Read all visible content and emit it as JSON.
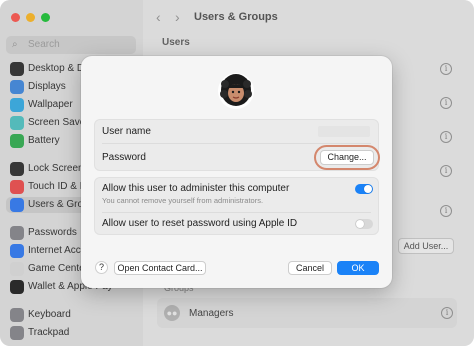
{
  "window": {
    "traffic_colors": [
      "#fe5f57",
      "#febc2e",
      "#28c840"
    ]
  },
  "sidebar": {
    "search_placeholder": "Search",
    "items": [
      {
        "label": "Desktop & Dock",
        "color": "#3a3a3a",
        "icon": "desktop-icon"
      },
      {
        "label": "Displays",
        "color": "#4a90e2",
        "icon": "display-icon"
      },
      {
        "label": "Wallpaper",
        "color": "#3fb2e9",
        "icon": "wallpaper-icon"
      },
      {
        "label": "Screen Saver",
        "color": "#5ac8c8",
        "icon": "screensaver-icon"
      },
      {
        "label": "Battery",
        "color": "#3cb35a",
        "icon": "battery-icon"
      },
      {
        "label": "Lock Screen",
        "color": "#3a3a3a",
        "icon": "lock-icon"
      },
      {
        "label": "Touch ID & Password",
        "color": "#f05656",
        "icon": "fingerprint-icon"
      },
      {
        "label": "Users & Groups",
        "color": "#3b82f6",
        "icon": "users-icon",
        "selected": true
      },
      {
        "label": "Passwords",
        "color": "#8e8e93",
        "icon": "key-icon"
      },
      {
        "label": "Internet Accounts",
        "color": "#3b82f6",
        "icon": "at-icon"
      },
      {
        "label": "Game Center",
        "color": "#e0e0e0",
        "icon": "game-center-icon"
      },
      {
        "label": "Wallet & Apple Pay",
        "color": "#2c2c2c",
        "icon": "wallet-icon"
      },
      {
        "label": "Keyboard",
        "color": "#8e8e93",
        "icon": "keyboard-icon"
      },
      {
        "label": "Trackpad",
        "color": "#8e8e93",
        "icon": "trackpad-icon"
      }
    ]
  },
  "main": {
    "title": "Users & Groups",
    "section": "Users",
    "add_user_label": "Add User...",
    "groups_label": "Groups",
    "group_name": "Managers"
  },
  "dialog": {
    "username_label": "User name",
    "password_label": "Password",
    "change_label": "Change...",
    "admin_label": "Allow this user to administer this computer",
    "admin_sub": "You cannot remove yourself from administrators.",
    "admin_enabled": true,
    "reset_label": "Allow user to reset password using Apple ID",
    "reset_enabled": false,
    "help_label": "?",
    "contact_label": "Open Contact Card...",
    "cancel_label": "Cancel",
    "ok_label": "OK",
    "accent_color": "#1a82f7",
    "highlight_color": "#d4876d"
  }
}
